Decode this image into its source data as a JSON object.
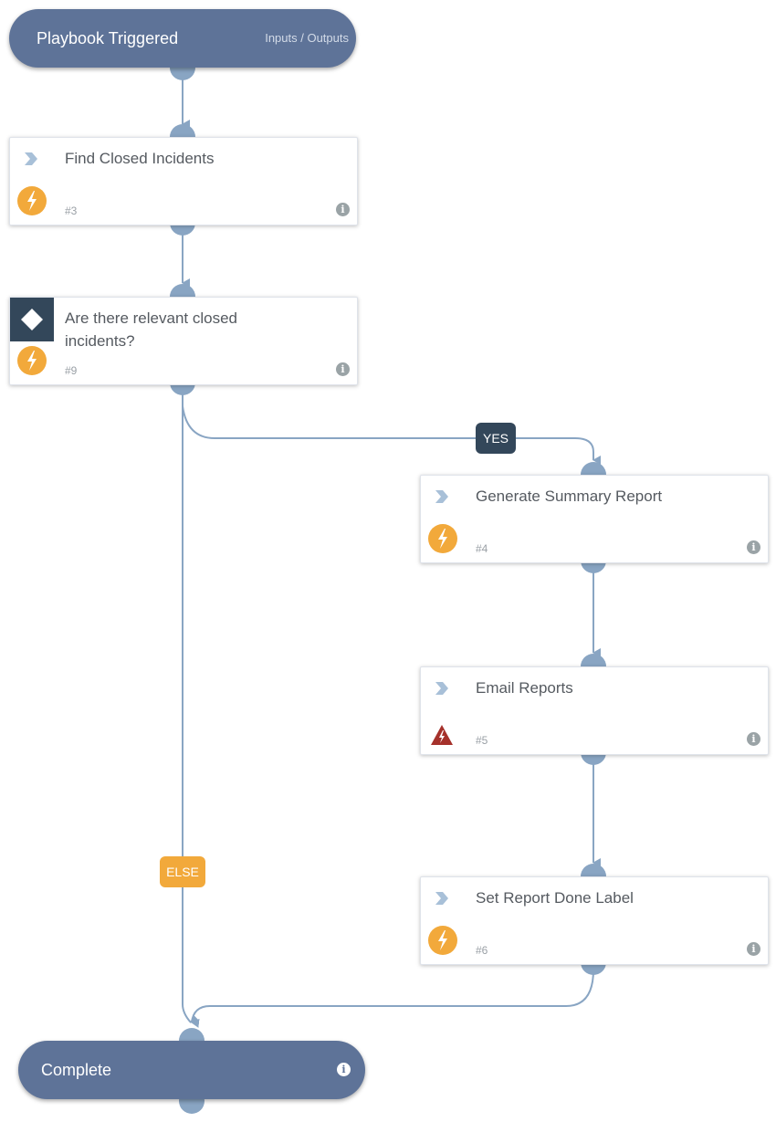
{
  "start": {
    "title": "Playbook Triggered",
    "io_link": "Inputs / Outputs"
  },
  "tasks": [
    {
      "name": "Find Closed Incidents",
      "number": "#3",
      "type": "task",
      "status_icon": "bolt-icon"
    },
    {
      "name": "Are there relevant closed incidents?",
      "number": "#9",
      "type": "condition",
      "status_icon": "bolt-icon"
    },
    {
      "name": "Generate Summary Report",
      "number": "#4",
      "type": "task",
      "status_icon": "bolt-icon"
    },
    {
      "name": "Email Reports",
      "number": "#5",
      "type": "task",
      "status_icon": "warning-icon"
    },
    {
      "name": "Set Report Done Label",
      "number": "#6",
      "type": "task",
      "status_icon": "bolt-icon"
    }
  ],
  "branches": {
    "yes": "YES",
    "else": "ELSE"
  },
  "end": {
    "title": "Complete",
    "info_glyph": "i"
  },
  "info_glyph": "i",
  "colors": {
    "pill": "#5e7398",
    "port": "#89a5c3",
    "edge": "#89a5c3",
    "condition": "#33475a",
    "bolt": "#f2a93b",
    "warning": "#a5312b"
  }
}
